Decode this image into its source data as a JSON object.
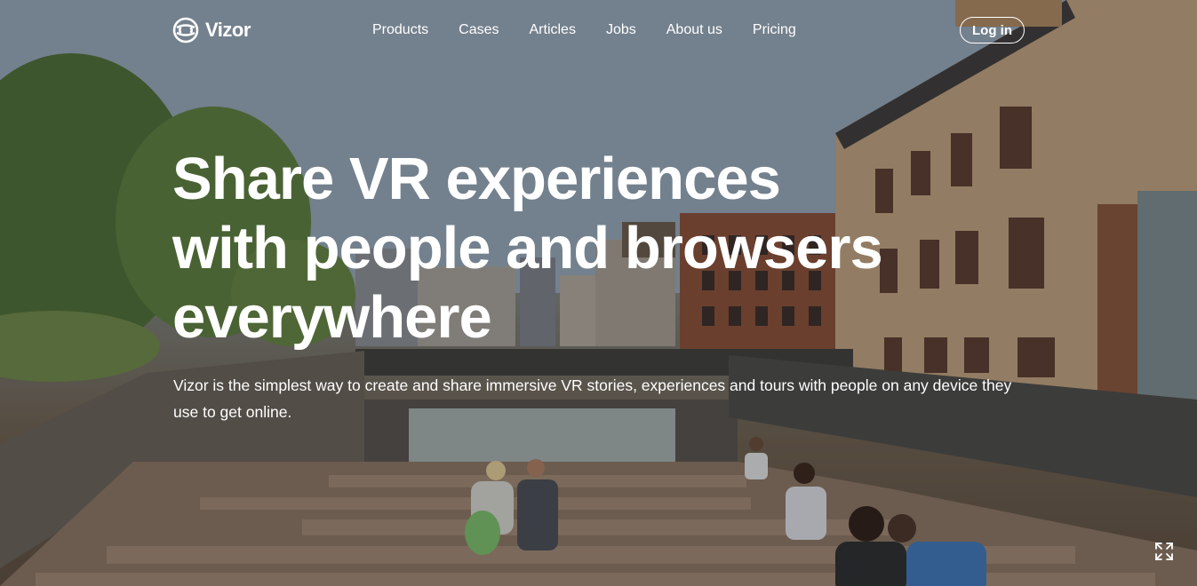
{
  "brand": {
    "name": "Vizor",
    "logo_icon": "vizor-logo-icon"
  },
  "nav": {
    "items": [
      {
        "label": "Products"
      },
      {
        "label": "Cases"
      },
      {
        "label": "Articles"
      },
      {
        "label": "Jobs"
      },
      {
        "label": "About us"
      },
      {
        "label": "Pricing"
      }
    ],
    "login_label": "Log in"
  },
  "hero": {
    "headline_lines": [
      "Share VR experiences",
      "with people and browsers",
      "everywhere"
    ],
    "subtitle": "Vizor is the simplest way to create and share immersive VR stories, experiences and tours with people on any device they use to get online.",
    "background": "panorama-photo-elevated-park-city-buildings",
    "fullscreen_icon": "fullscreen-icon"
  },
  "colors": {
    "text": "#ffffff",
    "sky": "#8fa3b5",
    "brick": "#8a5a3e",
    "wood": "#7a634c",
    "foliage": "#5d7a3c"
  }
}
